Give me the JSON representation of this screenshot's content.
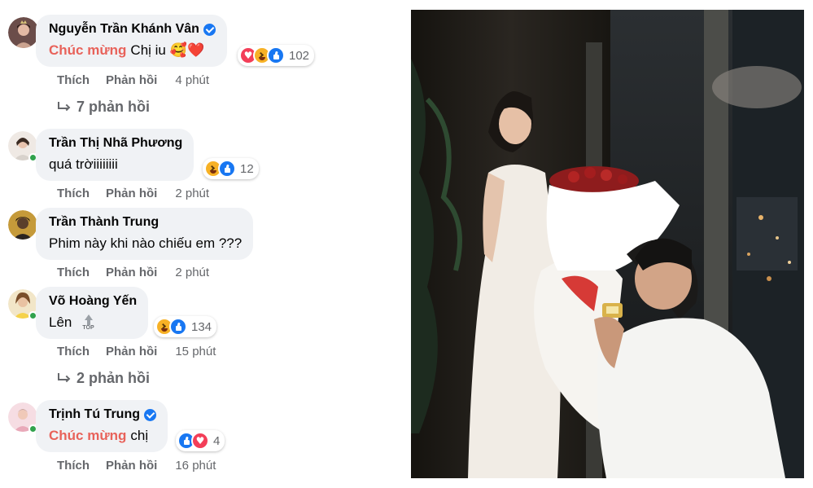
{
  "actions": {
    "like": "Thích",
    "reply": "Phản hồi"
  },
  "comments": [
    {
      "name": "Nguyễn Trần Khánh Vân",
      "verified": true,
      "tag": "Chúc mừng",
      "text": "Chị iu",
      "emoji": "🥰❤️",
      "reactions": [
        "love",
        "haha",
        "like"
      ],
      "count": "102",
      "time": "4 phút",
      "replies": "7 phản hồi",
      "online": false
    },
    {
      "name": "Trần Thị Nhã Phương",
      "verified": false,
      "text": "quá trờiiiiiiii",
      "reactions": [
        "haha",
        "like"
      ],
      "count": "12",
      "time": "2 phút",
      "online": true
    },
    {
      "name": "Trần Thành Trung",
      "verified": false,
      "text": "Phim này khi nào chiếu em ???",
      "time": "2 phút",
      "online": false
    },
    {
      "name": "Võ Hoàng Yến",
      "verified": false,
      "text": "Lên",
      "top_icon_label": "TOP",
      "reactions": [
        "haha",
        "like"
      ],
      "count": "134",
      "time": "15 phút",
      "replies": "2 phản hồi",
      "online": true
    },
    {
      "name": "Trịnh Tú Trung",
      "verified": true,
      "tag": "Chúc mừng",
      "text": "chị",
      "reactions": [
        "like",
        "love"
      ],
      "count": "4",
      "time": "16 phút",
      "online": true
    }
  ],
  "colors": {
    "bubble": "#f0f2f5",
    "tag": "#e8625a",
    "verified": "#1877f2",
    "online": "#31a24c",
    "secondary_text": "#65676b"
  }
}
